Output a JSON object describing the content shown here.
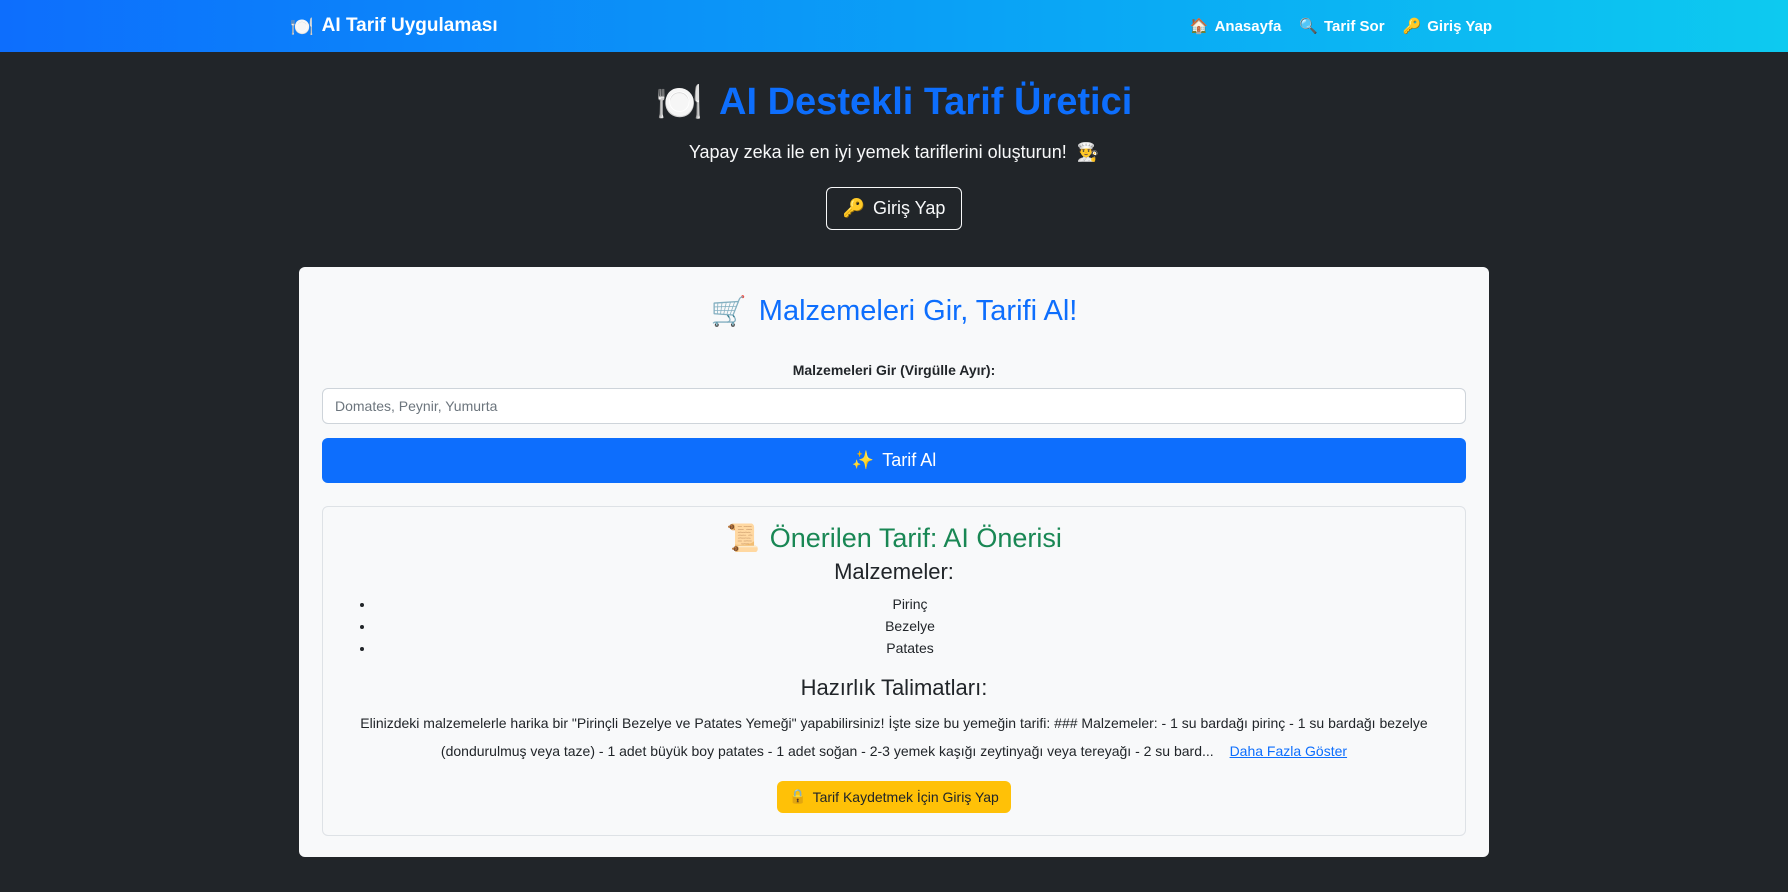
{
  "navbar": {
    "brand_icon": "🍽️",
    "brand_text": "AI Tarif Uygulaması",
    "links": [
      {
        "icon": "🏠",
        "label": "Anasayfa"
      },
      {
        "icon": "🔍",
        "label": "Tarif Sor"
      },
      {
        "icon": "🔑",
        "label": "Giriş Yap"
      }
    ]
  },
  "hero": {
    "title_icon": "🍽️",
    "title": "AI Destekli Tarif Üretici",
    "subtitle": "Yapay zeka ile en iyi yemek tariflerini oluşturun!",
    "subtitle_icon": "👨‍🍳",
    "login_icon": "🔑",
    "login_label": "Giriş Yap"
  },
  "form": {
    "heading_icon": "🛒",
    "heading": "Malzemeleri Gir, Tarifi Al!",
    "input_label": "Malzemeleri Gir (Virgülle Ayır):",
    "input_placeholder": "Domates, Peynir, Yumurta",
    "input_value": "",
    "submit_icon": "✨",
    "submit_label": "Tarif Al"
  },
  "recipe": {
    "title_icon": "📜",
    "title": "Önerilen Tarif: AI Önerisi",
    "ingredients_heading": "Malzemeler:",
    "ingredients": [
      "Pirinç",
      "Bezelye",
      "Patates"
    ],
    "instructions_heading": "Hazırlık Talimatları:",
    "instructions": "Elinizdeki malzemelerle harika bir \"Pirinçli Bezelye ve Patates Yemeği\" yapabilirsiniz! İşte size bu yemeğin tarifi: ### Malzemeler: - 1 su bardağı pirinç - 1 su bardağı bezelye (dondurulmuş veya taze) - 1 adet büyük boy patates - 1 adet soğan - 2-3 yemek kaşığı zeytinyağı veya tereyağı - 2 su bard...",
    "more_label": "Daha Fazla Göster",
    "save_icon": "🔒",
    "save_label": "Tarif Kaydetmek İçin Giriş Yap"
  },
  "colors": {
    "navbar_start": "#0d6efd",
    "navbar_end": "#0dcaf0",
    "background": "#212529",
    "primary": "#0d6efd",
    "success": "#198754",
    "warning": "#ffc107"
  }
}
